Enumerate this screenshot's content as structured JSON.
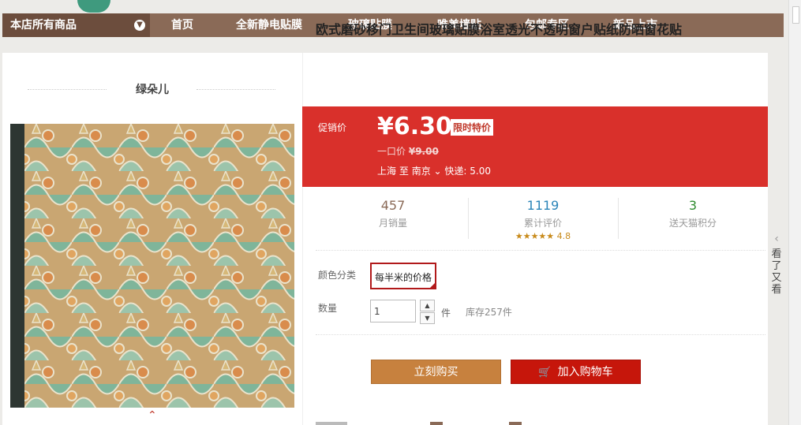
{
  "nav": {
    "all_products": "本店所有商品",
    "items": [
      "首页",
      "全新静电贴膜",
      "玻璃贴膜",
      "唯美墙贴",
      "包邮专区",
      "新品上市"
    ]
  },
  "shop": {
    "name": "绿朵儿"
  },
  "product": {
    "title": "欧式磨砂移门卫生间玻璃贴膜浴室透光不透明窗户贴纸防晒窗花贴",
    "promo_label": "促销价",
    "price": "¥6.30",
    "limited_badge": "限时特价",
    "orig_label": "一口价",
    "orig_price": "¥9.00",
    "ship_from": "上海",
    "ship_to_word": "至",
    "ship_to": "南京",
    "ship_fee": "快递: 5.00"
  },
  "stats": {
    "monthly_sales": "457",
    "monthly_sales_label": "月销量",
    "reviews": "1119",
    "reviews_label": "累计评价",
    "rating": "4.8",
    "stars": "★★★★★",
    "points": "3",
    "points_label": "送天猫积分"
  },
  "options": {
    "color_label": "颜色分类",
    "color_value": "每半米的价格",
    "qty_label": "数量",
    "qty_value": "1",
    "unit": "件",
    "stock": "库存257件"
  },
  "buttons": {
    "buy_now": "立刻购买",
    "add_cart": "加入购物车"
  },
  "sidebar": {
    "see_also": "看了又看"
  },
  "colors": {
    "nav_bg": "#8a6a57",
    "price_band": "#d9302b",
    "buy": "#c7813e",
    "cart": "#c6160b"
  }
}
